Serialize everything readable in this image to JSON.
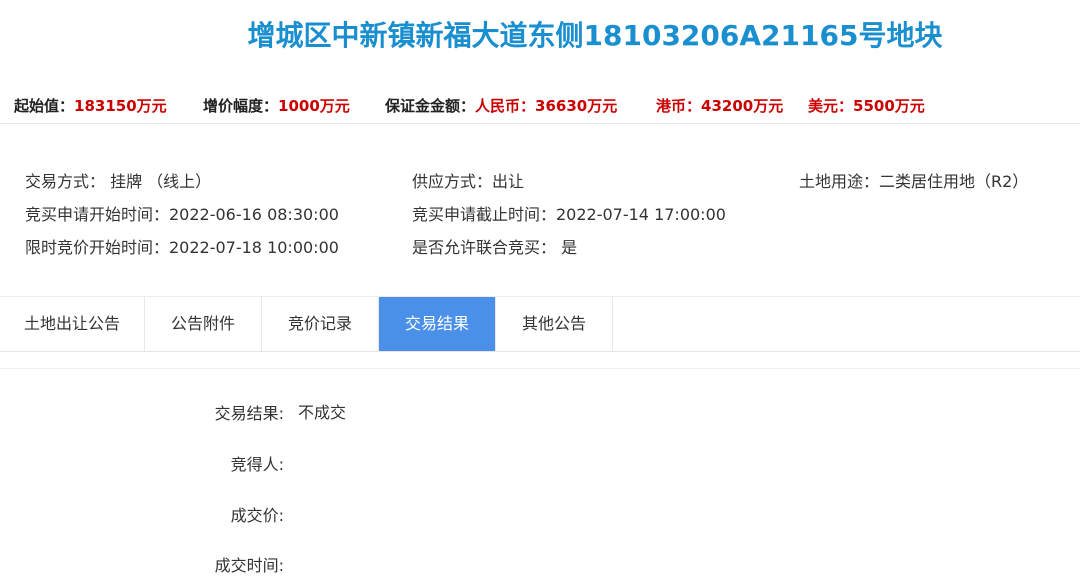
{
  "title": "增城区中新镇新福大道东侧18103206A21165号地块",
  "price": {
    "start_label": "起始值：",
    "start_value": "183150万元",
    "increment_label": "增价幅度：",
    "increment_value": "1000万元",
    "deposit_label": "保证金金额：",
    "rmb_label": "人民币：",
    "rmb_value": "36630万元",
    "hkd_label": "港币：",
    "hkd_value": "43200万元",
    "usd_label": "美元：",
    "usd_value": "5500万元"
  },
  "info": {
    "trade_method": "交易方式： 挂牌 （线上）",
    "supply_method": "供应方式：出让",
    "land_use": "土地用途：二类居住用地（R2）",
    "apply_start": "竞买申请开始时间：2022-06-16 08:30:00",
    "apply_end": "竞买申请截止时间：2022-07-14 17:00:00",
    "bid_start": "限时竞价开始时间：2022-07-18 10:00:00",
    "joint_bid": "是否允许联合竞买： 是"
  },
  "tabs": [
    {
      "label": "土地出让公告",
      "active": false
    },
    {
      "label": "公告附件",
      "active": false
    },
    {
      "label": "竞价记录",
      "active": false
    },
    {
      "label": "交易结果",
      "active": true
    },
    {
      "label": "其他公告",
      "active": false
    }
  ],
  "result": {
    "result_label": "交易结果:",
    "result_value": "不成交",
    "winner_label": "竞得人:",
    "winner_value": "",
    "price_label": "成交价:",
    "price_value": "",
    "time_label": "成交时间:",
    "time_value": ""
  },
  "colors": {
    "title": "#1a8fd0",
    "price_value": "#cc0000",
    "active_tab": "#4a90e8"
  }
}
